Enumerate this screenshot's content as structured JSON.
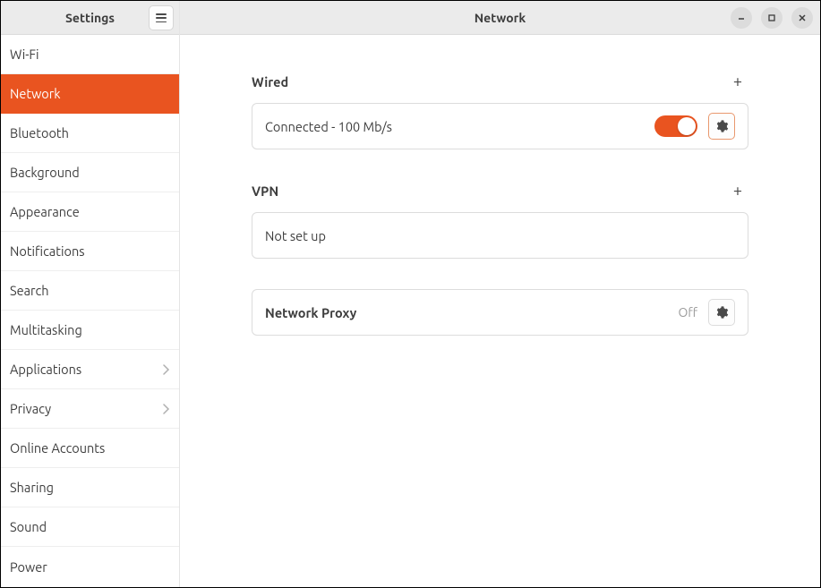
{
  "sidebar": {
    "title": "Settings",
    "items": [
      {
        "label": "Wi-Fi",
        "active": false,
        "chevron": false
      },
      {
        "label": "Network",
        "active": true,
        "chevron": false
      },
      {
        "label": "Bluetooth",
        "active": false,
        "chevron": false
      },
      {
        "label": "Background",
        "active": false,
        "chevron": false
      },
      {
        "label": "Appearance",
        "active": false,
        "chevron": false
      },
      {
        "label": "Notifications",
        "active": false,
        "chevron": false
      },
      {
        "label": "Search",
        "active": false,
        "chevron": false
      },
      {
        "label": "Multitasking",
        "active": false,
        "chevron": false
      },
      {
        "label": "Applications",
        "active": false,
        "chevron": true
      },
      {
        "label": "Privacy",
        "active": false,
        "chevron": true
      },
      {
        "label": "Online Accounts",
        "active": false,
        "chevron": false
      },
      {
        "label": "Sharing",
        "active": false,
        "chevron": false
      },
      {
        "label": "Sound",
        "active": false,
        "chevron": false
      },
      {
        "label": "Power",
        "active": false,
        "chevron": false
      }
    ]
  },
  "header": {
    "title": "Network"
  },
  "wired": {
    "title": "Wired",
    "status": "Connected - 100 Mb/s",
    "toggle_on": true
  },
  "vpn": {
    "title": "VPN",
    "status": "Not set up"
  },
  "proxy": {
    "title": "Network Proxy",
    "status": "Off"
  },
  "colors": {
    "accent": "#e95420"
  }
}
